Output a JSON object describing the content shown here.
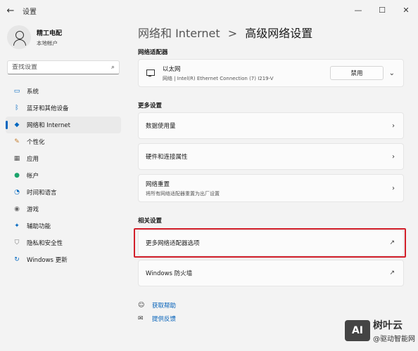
{
  "window": {
    "title": "设置",
    "controls": {
      "minimize": "—",
      "maximize": "☐",
      "close": "✕"
    }
  },
  "profile": {
    "name": "精工电配",
    "account_type": "本地帐户"
  },
  "search": {
    "placeholder": "查找设置"
  },
  "nav": {
    "items": [
      {
        "label": "系统",
        "icon": "monitor-icon",
        "glyph": "▭",
        "color": "#0067c0"
      },
      {
        "label": "蓝牙和其他设备",
        "icon": "bluetooth-icon",
        "glyph": "ᛒ",
        "color": "#0067c0"
      },
      {
        "label": "网络和 Internet",
        "icon": "wifi-icon",
        "glyph": "◆",
        "color": "#0067c0",
        "active": true
      },
      {
        "label": "个性化",
        "icon": "brush-icon",
        "glyph": "✎",
        "color": "#c47b2a"
      },
      {
        "label": "应用",
        "icon": "apps-icon",
        "glyph": "▦",
        "color": "#555555"
      },
      {
        "label": "帐户",
        "icon": "person-icon",
        "glyph": "●",
        "color": "#1aa36b"
      },
      {
        "label": "时间和语言",
        "icon": "globe-clock-icon",
        "glyph": "◔",
        "color": "#0067c0"
      },
      {
        "label": "游戏",
        "icon": "gamepad-icon",
        "glyph": "◉",
        "color": "#666666"
      },
      {
        "label": "辅助功能",
        "icon": "accessibility-icon",
        "glyph": "✦",
        "color": "#0067c0"
      },
      {
        "label": "隐私和安全性",
        "icon": "shield-icon",
        "glyph": "⛉",
        "color": "#777777"
      },
      {
        "label": "Windows 更新",
        "icon": "update-icon",
        "glyph": "↻",
        "color": "#0067c0"
      }
    ]
  },
  "breadcrumb": {
    "parent": "网络和 Internet",
    "separator": ">",
    "current": "高级网络设置"
  },
  "sections": {
    "adapters": "网络适配器",
    "more": "更多设置",
    "related": "相关设置"
  },
  "adapter": {
    "name": "以太网",
    "description": "网络 | Intel(R) Ethernet Connection (7) I219-V",
    "disable_label": "禁用"
  },
  "more_settings": [
    {
      "title": "数据使用量",
      "subtitle": ""
    },
    {
      "title": "硬件和连接属性",
      "subtitle": ""
    },
    {
      "title": "网络重置",
      "subtitle": "将所有网络适配器重置为出厂设置"
    }
  ],
  "related_settings": [
    {
      "title": "更多网络适配器选项"
    },
    {
      "title": "Windows 防火墙"
    }
  ],
  "help": {
    "get_help": "获取帮助",
    "feedback": "提供反馈"
  },
  "watermark": {
    "logo": "AI",
    "brand": "树叶云",
    "sub": "@驱动智能网"
  },
  "colors": {
    "accent": "#0067c0",
    "highlight": "#d21f2a",
    "link": "#005fb8"
  }
}
